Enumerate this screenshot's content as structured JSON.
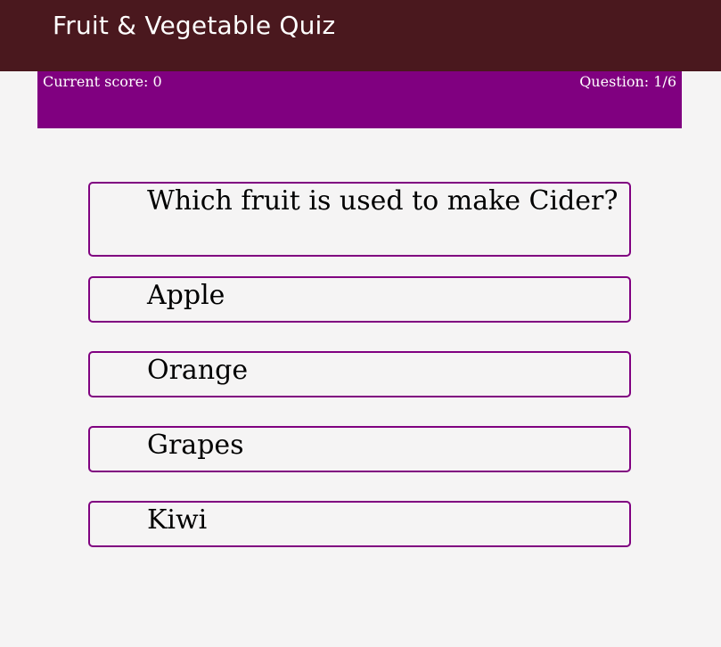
{
  "header": {
    "title": "Fruit & Vegetable Quiz"
  },
  "status": {
    "score": "Current score: 0",
    "question_counter": "Question: 1/6"
  },
  "quiz": {
    "question": "Which fruit is used to make Cider?",
    "answers": [
      "Apple",
      "Orange",
      "Grapes",
      "Kiwi"
    ]
  },
  "colors": {
    "header_bg": "#4a181e",
    "accent": "#800080",
    "page_bg": "#f5f4f4"
  }
}
